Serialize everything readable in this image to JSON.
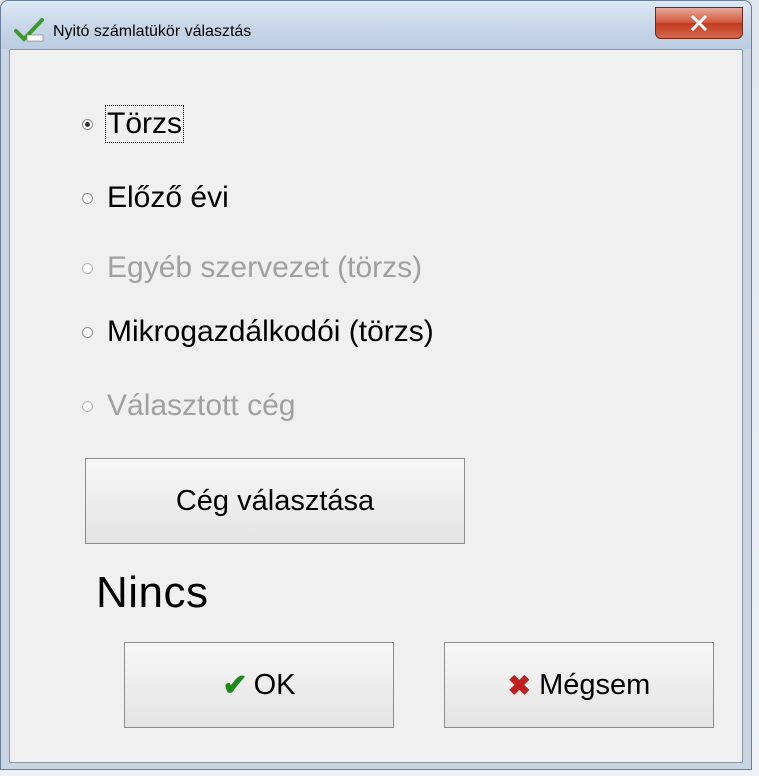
{
  "window": {
    "title": "Nyitó számlatükör választás",
    "close_label": "x"
  },
  "options": [
    {
      "label": "Törzs",
      "checked": true,
      "disabled": false,
      "focused": true
    },
    {
      "label": "Előző évi",
      "checked": false,
      "disabled": false,
      "focused": false
    },
    {
      "label": "Egyéb szervezet (törzs)",
      "checked": false,
      "disabled": true,
      "focused": false
    },
    {
      "label": "Mikrogazdálkodói (törzs)",
      "checked": false,
      "disabled": false,
      "focused": false
    },
    {
      "label": "Választott cég",
      "checked": false,
      "disabled": true,
      "focused": false
    }
  ],
  "select_company_button": "Cég választása",
  "selected_company_text": "Nincs",
  "buttons": {
    "ok": {
      "label": "OK",
      "icon": "checkmark-icon",
      "icon_color": "#1b8a1b"
    },
    "cancel": {
      "label": "Mégsem",
      "icon": "cross-icon",
      "icon_color": "#c01e1e"
    }
  }
}
